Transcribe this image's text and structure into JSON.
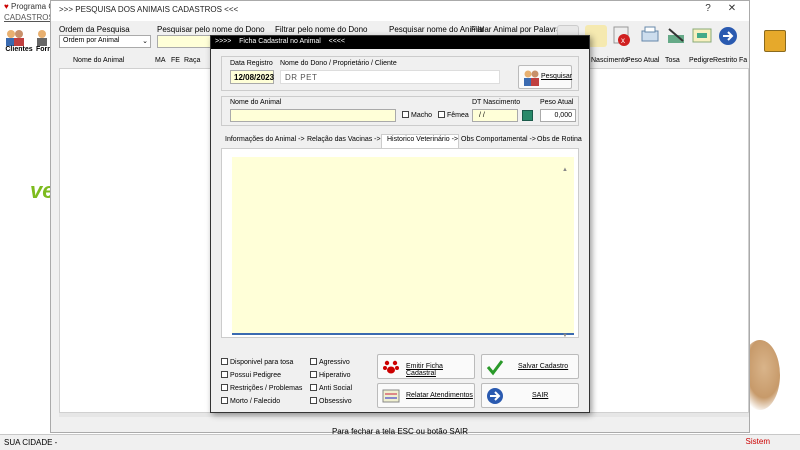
{
  "background": {
    "app_title": "Programa C",
    "menu_cadastros": "CADASTROS",
    "tool_clientes": "Clientes",
    "tool_fornecedores": "Forn",
    "logo_text": "ve",
    "status_left": "SUA CIDADE -",
    "status_right": "Sistem"
  },
  "search_window": {
    "title": ">>> PESQUISA DOS ANIMAIS CADASTROS <<<",
    "ordem_label": "Ordem da Pesquisa",
    "ordem_value": "Ordem por Animal",
    "pesq_dono_label": "Pesquisar pelo nome do Dono",
    "filtrar_dono_label": "Filtrar pelo nome do Dono",
    "pesq_nome_label": "Pesquisar nome do Animal",
    "filtrar_animal_label": "Filtrar Animal por Palavra",
    "columns_left": [
      "Nome do Animal",
      "MA",
      "FE",
      "Raça"
    ],
    "columns_right": [
      "Nascimento",
      "Peso Atual",
      "Tosa",
      "Pedigre",
      "Restrito",
      "Fa"
    ],
    "footer": "Para fechar a tela ESC ou botão SAIR",
    "ctrl_help": "?",
    "ctrl_close": "✕"
  },
  "modal": {
    "title": ">>>>    Ficha Cadastral no Animal    <<<<",
    "data_registro_label": "Data Registro",
    "data_registro_value": "12/08/2023",
    "dono_label": "Nome do Dono / Proprietário / Cliente",
    "dono_value": "DR PET",
    "pesquisar_button": "Pesquisar",
    "nome_animal_label": "Nome do Animal",
    "macho_label": "Macho",
    "femea_label": "Fêmea",
    "dt_nasc_label": "DT Nascimento",
    "dt_nasc_value": "/  /",
    "peso_label": "Peso Atual",
    "peso_value": "0,000",
    "tabs": [
      "Informações do Animal ->",
      "Relação das Vacinas ->",
      "Historico Veterinário ->",
      "Obs Comportamental ->",
      "Obs de Rotina"
    ],
    "options": [
      "Disponivel para tosa",
      "Possui Pedigree",
      "Restrições / Problemas",
      "Morto / Falecido"
    ],
    "behaviors": [
      "Agressivo",
      "Hiperativo",
      "Anti Social",
      "Obsessivo"
    ],
    "btn_emitir": "Emitir Ficha Cadastral",
    "btn_salvar": "Salvar Cadastro",
    "btn_relatar": "Relatar Atendimentos",
    "btn_sair": "SAIR"
  },
  "colors": {
    "input_yellow": "#ffffd8",
    "title_black": "#000000",
    "accent_blue": "#3a6ab0",
    "logo_green": "#7dbb1e"
  }
}
